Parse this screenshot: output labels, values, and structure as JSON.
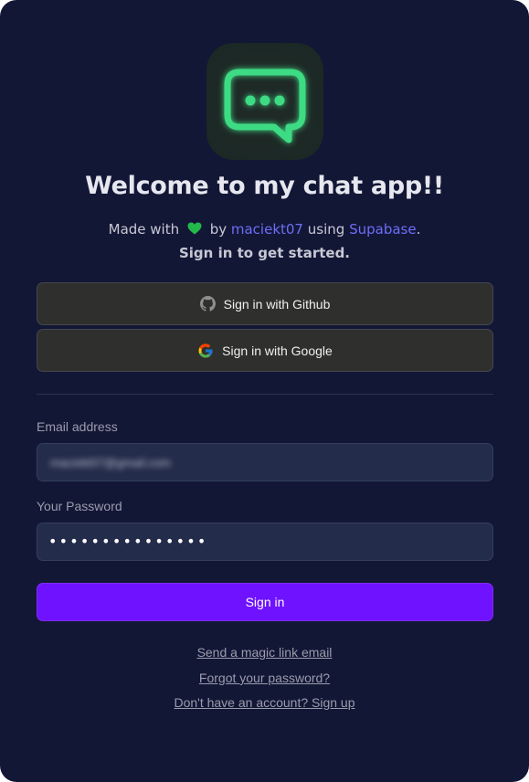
{
  "header": {
    "logo_icon": "chat-bubble-icon",
    "title": "Welcome to my chat app!!",
    "made_with_prefix": "Made with",
    "heart_icon": "green-heart-icon",
    "by_text": "by",
    "author": "maciekt07",
    "using_text": "using",
    "provider": "Supabase",
    "period": ".",
    "subtitle": "Sign in to get started."
  },
  "oauth": {
    "github_label": "Sign in with Github",
    "github_icon": "github-icon",
    "google_label": "Sign in with Google",
    "google_icon": "google-icon"
  },
  "form": {
    "email_label": "Email address",
    "email_value": "maciekt07@gmail.com",
    "password_label": "Your Password",
    "password_value": "•••••••••••••••",
    "submit_label": "Sign in"
  },
  "links": {
    "magic_link": "Send a magic link email",
    "forgot_password": "Forgot your password?",
    "sign_up": "Don't have an account? Sign up"
  },
  "colors": {
    "background": "#131736",
    "accent": "#6f12ff",
    "link": "#6c6ef7",
    "logo_green": "#3ddc84"
  }
}
